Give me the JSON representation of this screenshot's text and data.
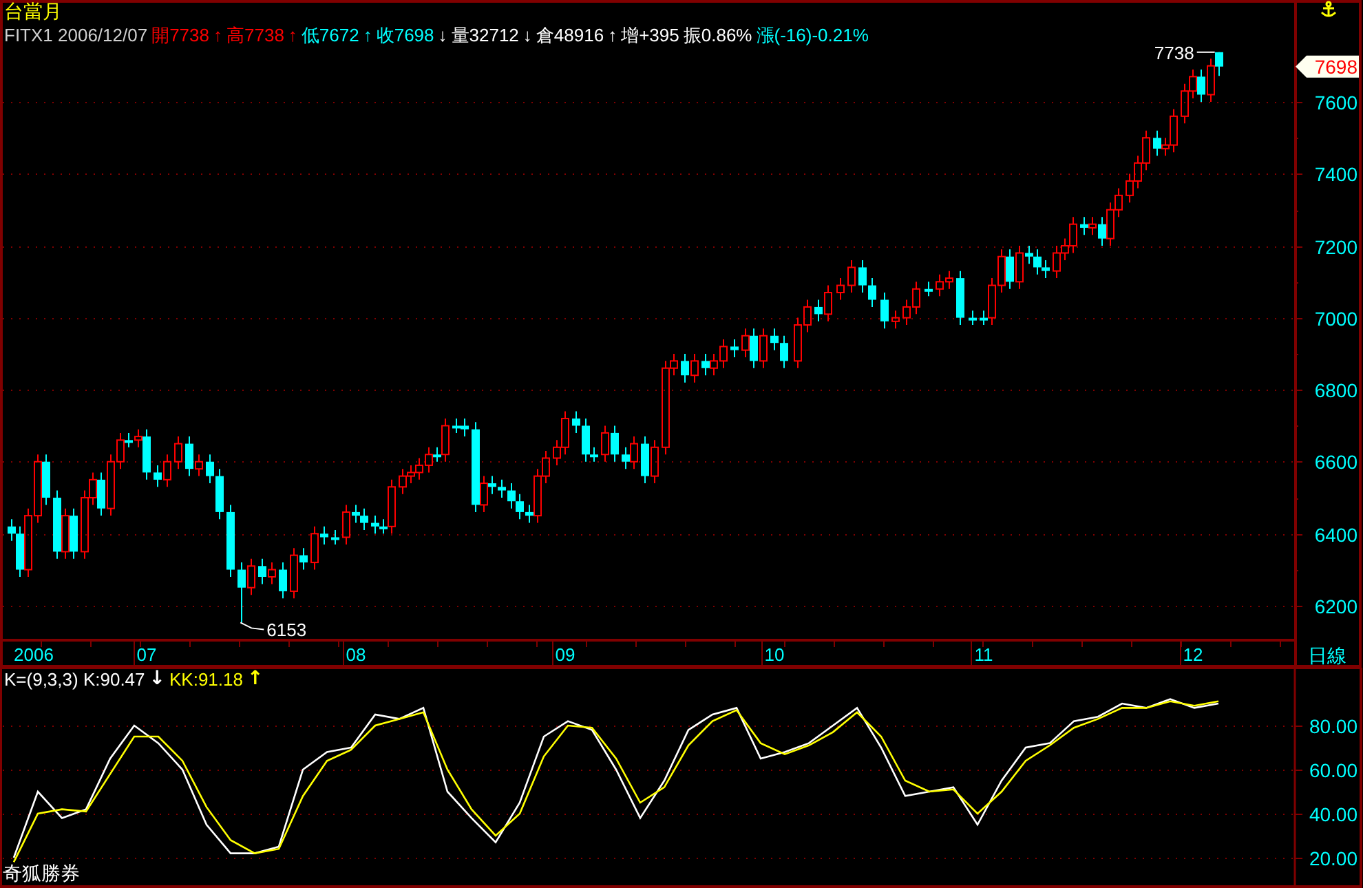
{
  "title": "台當月",
  "quote": [
    {
      "text": "FITX1 2006/12/07",
      "color": "#d0d0d0"
    },
    {
      "text": "開7738",
      "color": "#ff0000"
    },
    {
      "text": "↑",
      "color": "#ff0000"
    },
    {
      "text": "高7738",
      "color": "#ff0000"
    },
    {
      "text": "↑",
      "color": "#ff0000"
    },
    {
      "text": "低7672",
      "color": "#00ffff"
    },
    {
      "text": "↑",
      "color": "#00ffff"
    },
    {
      "text": "收7698",
      "color": "#00ffff"
    },
    {
      "text": "↓",
      "color": "#ffffff"
    },
    {
      "text": "量32712",
      "color": "#ffffff"
    },
    {
      "text": "↓",
      "color": "#ffffff"
    },
    {
      "text": "倉48916",
      "color": "#ffffff"
    },
    {
      "text": "↑",
      "color": "#ffffff"
    },
    {
      "text": "增+395",
      "color": "#ffffff"
    },
    {
      "text": "振0.86%",
      "color": "#ffffff"
    },
    {
      "text": "漲(-16)-0.21%",
      "color": "#00ffff"
    }
  ],
  "price_chart": {
    "last_price": "7698",
    "period": "日線",
    "year_label": "2006",
    "chart_data": {
      "type": "candlestick",
      "grid": true,
      "x": [
        6.35,
        6.39,
        6.43,
        6.48,
        6.52,
        6.57,
        6.61,
        6.65,
        6.7,
        6.74,
        6.78,
        6.83,
        6.87,
        6.91,
        6.96,
        7.0,
        7.05,
        7.1,
        7.15,
        7.2,
        7.25,
        7.3,
        7.35,
        7.4,
        7.45,
        7.5,
        7.55,
        7.6,
        7.65,
        7.7,
        7.75,
        7.8,
        7.85,
        7.9,
        7.95,
        8.0,
        8.04,
        8.09,
        8.13,
        8.17,
        8.22,
        8.26,
        8.3,
        8.35,
        8.39,
        8.43,
        8.48,
        8.52,
        8.57,
        8.61,
        8.65,
        8.7,
        8.74,
        8.78,
        8.83,
        8.87,
        8.91,
        8.96,
        9.0,
        9.05,
        9.1,
        9.14,
        9.19,
        9.24,
        9.29,
        9.33,
        9.38,
        9.43,
        9.48,
        9.52,
        9.57,
        9.62,
        9.67,
        9.71,
        9.76,
        9.81,
        9.86,
        9.9,
        9.95,
        10.0,
        10.05,
        10.11,
        10.16,
        10.21,
        10.26,
        10.32,
        10.37,
        10.42,
        10.47,
        10.53,
        10.58,
        10.63,
        10.68,
        10.74,
        10.79,
        10.84,
        10.89,
        10.95,
        11.0,
        11.04,
        11.09,
        11.13,
        11.17,
        11.22,
        11.26,
        11.3,
        11.35,
        11.39,
        11.43,
        11.48,
        11.52,
        11.57,
        11.61,
        11.65,
        11.7,
        11.74,
        11.78,
        11.83,
        11.87,
        11.91,
        11.96,
        12.0,
        12.04,
        12.09,
        12.13
      ],
      "ohlc": [
        [
          6420,
          6440,
          6380,
          6400
        ],
        [
          6400,
          6420,
          6280,
          6300
        ],
        [
          6300,
          6470,
          6280,
          6450
        ],
        [
          6450,
          6620,
          6430,
          6600
        ],
        [
          6600,
          6620,
          6480,
          6500
        ],
        [
          6500,
          6520,
          6330,
          6350
        ],
        [
          6350,
          6470,
          6330,
          6450
        ],
        [
          6450,
          6470,
          6330,
          6350
        ],
        [
          6350,
          6520,
          6330,
          6500
        ],
        [
          6500,
          6570,
          6480,
          6550
        ],
        [
          6550,
          6570,
          6450,
          6470
        ],
        [
          6470,
          6620,
          6450,
          6600
        ],
        [
          6600,
          6680,
          6580,
          6660
        ],
        [
          6660,
          6680,
          6640,
          6660
        ],
        [
          6660,
          6690,
          6640,
          6670
        ],
        [
          6670,
          6690,
          6550,
          6570
        ],
        [
          6570,
          6590,
          6530,
          6550
        ],
        [
          6550,
          6620,
          6530,
          6600
        ],
        [
          6600,
          6670,
          6580,
          6650
        ],
        [
          6650,
          6670,
          6560,
          6580
        ],
        [
          6580,
          6620,
          6560,
          6600
        ],
        [
          6600,
          6620,
          6540,
          6560
        ],
        [
          6560,
          6580,
          6440,
          6460
        ],
        [
          6460,
          6480,
          6280,
          6300
        ],
        [
          6300,
          6320,
          6153,
          6250
        ],
        [
          6250,
          6330,
          6230,
          6310
        ],
        [
          6310,
          6330,
          6260,
          6280
        ],
        [
          6280,
          6320,
          6260,
          6300
        ],
        [
          6300,
          6320,
          6220,
          6240
        ],
        [
          6240,
          6360,
          6220,
          6340
        ],
        [
          6340,
          6360,
          6300,
          6320
        ],
        [
          6320,
          6420,
          6300,
          6400
        ],
        [
          6400,
          6420,
          6370,
          6390
        ],
        [
          6390,
          6410,
          6370,
          6390
        ],
        [
          6390,
          6480,
          6370,
          6460
        ],
        [
          6460,
          6480,
          6430,
          6450
        ],
        [
          6450,
          6470,
          6410,
          6430
        ],
        [
          6430,
          6450,
          6400,
          6420
        ],
        [
          6420,
          6440,
          6400,
          6420
        ],
        [
          6420,
          6550,
          6400,
          6530
        ],
        [
          6530,
          6580,
          6510,
          6560
        ],
        [
          6560,
          6590,
          6540,
          6570
        ],
        [
          6570,
          6610,
          6550,
          6590
        ],
        [
          6590,
          6640,
          6570,
          6620
        ],
        [
          6620,
          6640,
          6600,
          6620
        ],
        [
          6620,
          6720,
          6600,
          6700
        ],
        [
          6700,
          6720,
          6680,
          6700
        ],
        [
          6700,
          6720,
          6670,
          6690
        ],
        [
          6690,
          6710,
          6460,
          6480
        ],
        [
          6480,
          6560,
          6460,
          6540
        ],
        [
          6540,
          6560,
          6510,
          6530
        ],
        [
          6530,
          6550,
          6500,
          6520
        ],
        [
          6520,
          6540,
          6470,
          6490
        ],
        [
          6490,
          6510,
          6440,
          6460
        ],
        [
          6460,
          6480,
          6430,
          6450
        ],
        [
          6450,
          6580,
          6430,
          6560
        ],
        [
          6560,
          6630,
          6540,
          6610
        ],
        [
          6610,
          6660,
          6590,
          6640
        ],
        [
          6640,
          6740,
          6620,
          6720
        ],
        [
          6720,
          6740,
          6680,
          6700
        ],
        [
          6700,
          6720,
          6600,
          6620
        ],
        [
          6620,
          6640,
          6600,
          6620
        ],
        [
          6620,
          6700,
          6600,
          6680
        ],
        [
          6680,
          6700,
          6600,
          6620
        ],
        [
          6620,
          6640,
          6580,
          6600
        ],
        [
          6600,
          6670,
          6580,
          6650
        ],
        [
          6650,
          6670,
          6540,
          6560
        ],
        [
          6560,
          6660,
          6540,
          6640
        ],
        [
          6640,
          6880,
          6620,
          6860
        ],
        [
          6860,
          6900,
          6840,
          6880
        ],
        [
          6880,
          6900,
          6820,
          6840
        ],
        [
          6840,
          6900,
          6820,
          6880
        ],
        [
          6880,
          6900,
          6840,
          6860
        ],
        [
          6860,
          6900,
          6840,
          6880
        ],
        [
          6880,
          6940,
          6860,
          6920
        ],
        [
          6920,
          6940,
          6890,
          6910
        ],
        [
          6910,
          6970,
          6890,
          6950
        ],
        [
          6950,
          6970,
          6860,
          6880
        ],
        [
          6880,
          6970,
          6860,
          6950
        ],
        [
          6950,
          6970,
          6910,
          6930
        ],
        [
          6930,
          6950,
          6860,
          6880
        ],
        [
          6880,
          7000,
          6860,
          6980
        ],
        [
          6980,
          7050,
          6960,
          7030
        ],
        [
          7030,
          7050,
          6990,
          7010
        ],
        [
          7010,
          7090,
          6990,
          7070
        ],
        [
          7070,
          7110,
          7050,
          7090
        ],
        [
          7090,
          7160,
          7070,
          7140
        ],
        [
          7140,
          7160,
          7070,
          7090
        ],
        [
          7090,
          7110,
          7030,
          7050
        ],
        [
          7050,
          7070,
          6970,
          6990
        ],
        [
          6990,
          7020,
          6970,
          7000
        ],
        [
          7000,
          7050,
          6980,
          7030
        ],
        [
          7030,
          7100,
          7010,
          7080
        ],
        [
          7080,
          7100,
          7060,
          7080
        ],
        [
          7080,
          7120,
          7060,
          7100
        ],
        [
          7100,
          7130,
          7080,
          7110
        ],
        [
          7110,
          7130,
          6980,
          7000
        ],
        [
          7000,
          7020,
          6980,
          7000
        ],
        [
          7000,
          7020,
          6980,
          7000
        ],
        [
          7000,
          7110,
          6980,
          7090
        ],
        [
          7090,
          7190,
          7070,
          7170
        ],
        [
          7170,
          7190,
          7080,
          7100
        ],
        [
          7100,
          7200,
          7080,
          7180
        ],
        [
          7180,
          7200,
          7150,
          7170
        ],
        [
          7170,
          7190,
          7120,
          7140
        ],
        [
          7140,
          7160,
          7110,
          7130
        ],
        [
          7130,
          7200,
          7110,
          7180
        ],
        [
          7180,
          7220,
          7160,
          7200
        ],
        [
          7200,
          7280,
          7180,
          7260
        ],
        [
          7260,
          7280,
          7230,
          7250
        ],
        [
          7250,
          7280,
          7230,
          7260
        ],
        [
          7260,
          7280,
          7200,
          7220
        ],
        [
          7220,
          7320,
          7200,
          7300
        ],
        [
          7300,
          7360,
          7280,
          7340
        ],
        [
          7340,
          7400,
          7320,
          7380
        ],
        [
          7380,
          7450,
          7360,
          7430
        ],
        [
          7430,
          7520,
          7410,
          7500
        ],
        [
          7500,
          7520,
          7450,
          7470
        ],
        [
          7470,
          7500,
          7450,
          7480
        ],
        [
          7480,
          7580,
          7460,
          7560
        ],
        [
          7560,
          7650,
          7540,
          7630
        ],
        [
          7630,
          7690,
          7610,
          7670
        ],
        [
          7670,
          7690,
          7600,
          7620
        ],
        [
          7620,
          7720,
          7600,
          7700
        ],
        [
          7738,
          7738,
          7672,
          7698
        ]
      ],
      "ylim": [
        6104,
        7883
      ],
      "yticks": [
        {
          "value": 6200,
          "label": "6200"
        },
        {
          "value": 6400,
          "label": "6400"
        },
        {
          "value": 6600,
          "label": "6600"
        },
        {
          "value": 6800,
          "label": "6800"
        },
        {
          "value": 7000,
          "label": "7000"
        },
        {
          "value": 7200,
          "label": "7200"
        },
        {
          "value": 7400,
          "label": "7400"
        },
        {
          "value": 7600,
          "label": "7600"
        }
      ],
      "xticks": [
        {
          "value": 7,
          "label": "07"
        },
        {
          "value": 8,
          "label": "08"
        },
        {
          "value": 9,
          "label": "09"
        },
        {
          "value": 10,
          "label": "10"
        },
        {
          "value": 11,
          "label": "11"
        },
        {
          "value": 12,
          "label": "12"
        }
      ],
      "xlim": [
        6.3,
        12.49
      ],
      "annotations": [
        "7738",
        "6153"
      ]
    }
  },
  "kd_chart": {
    "legend": [
      {
        "text": "K=(9,3,3) K:90.47",
        "color": "#ffffff"
      },
      {
        "text": "↓",
        "color": "#ffffff"
      },
      {
        "text": "KK:91.18",
        "color": "#ffff00"
      },
      {
        "text": "↑",
        "color": "#ffff00"
      }
    ],
    "chart_data": {
      "type": "line",
      "grid": true,
      "series": [
        {
          "color": "#ffffff",
          "values": [
            20,
            50,
            38,
            42,
            65,
            80,
            72,
            60,
            35,
            22,
            22,
            25,
            60,
            68,
            70,
            85,
            83,
            88,
            50,
            38,
            27,
            45,
            75,
            82,
            78,
            60,
            38,
            55,
            78,
            85,
            88,
            65,
            68,
            72,
            80,
            88,
            70,
            48,
            50,
            52,
            35,
            55,
            70,
            72,
            82,
            84,
            90,
            88,
            92,
            88,
            90
          ]
        },
        {
          "color": "#ffff00",
          "values": [
            18,
            40,
            42,
            41,
            58,
            75,
            75,
            64,
            43,
            28,
            22,
            24,
            48,
            64,
            69,
            80,
            83,
            86,
            60,
            42,
            30,
            40,
            66,
            80,
            79,
            65,
            45,
            52,
            71,
            82,
            87,
            72,
            67,
            71,
            77,
            86,
            75,
            55,
            50,
            51,
            40,
            50,
            64,
            71,
            79,
            83,
            88,
            88,
            91,
            89,
            91
          ]
        }
      ],
      "ylim": [
        6.25,
        106.25
      ],
      "yticks": [
        {
          "value": 20,
          "label": "20.00"
        },
        {
          "value": 40,
          "label": "40.00"
        },
        {
          "value": 60,
          "label": "60.00"
        },
        {
          "value": 80,
          "label": "80.00"
        }
      ]
    }
  },
  "brand": "奇狐勝券"
}
